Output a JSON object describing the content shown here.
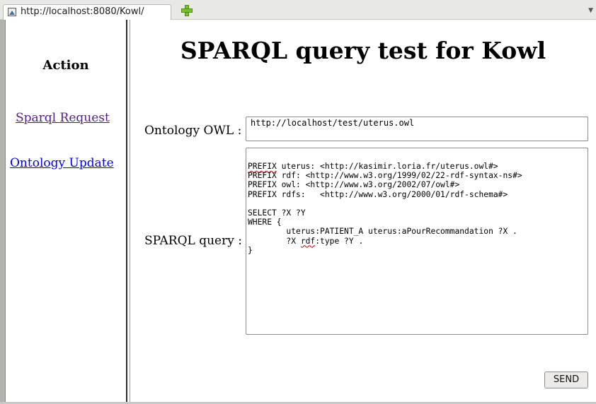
{
  "tab": {
    "title": "http://localhost:8080/Kowl/",
    "favicon_icon": "page-favicon-icon",
    "new_tab_icon": "plus-icon",
    "tab_menu_glyph": "▼"
  },
  "sidebar": {
    "title": "Action",
    "links": [
      {
        "label": "Sparql Request",
        "color": "#551a8b"
      },
      {
        "label": "Ontology Update",
        "color": "#0000ee"
      }
    ]
  },
  "main": {
    "title": "SPARQL query test for Kowl",
    "ontology_label": "Ontology OWL :",
    "ontology_value": "http://localhost/test/uterus.owl",
    "sparql_label": "SPARQL query :",
    "query_lines": [
      "PREFIX uterus: <http://kasimir.loria.fr/uterus.owl#>",
      "PREFIX rdf: <http://www.w3.org/1999/02/22-rdf-syntax-ns#>",
      "PREFIX owl: <http://www.w3.org/2002/07/owl#>",
      "PREFIX rdfs:   <http://www.w3.org/2000/01/rdf-schema#>",
      "",
      "SELECT ?X ?Y",
      "WHERE {",
      "        uterus:PATIENT_A uterus:aPourRecommandation ?X .",
      "        ?X rdf:type ?Y .",
      "}"
    ],
    "send_label": "SEND"
  }
}
